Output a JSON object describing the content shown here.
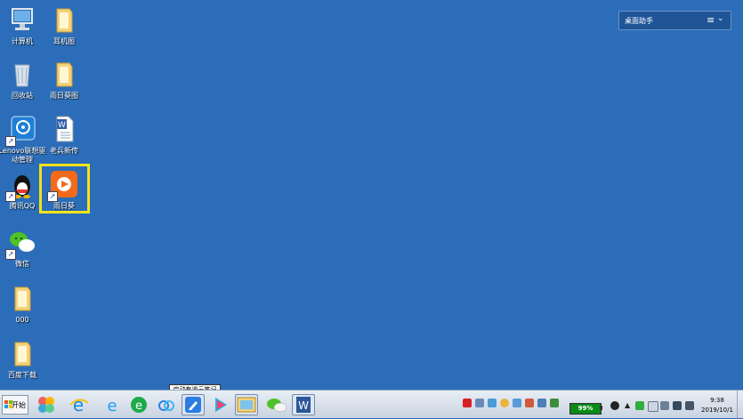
{
  "desktop": {
    "icons": [
      {
        "label": "计算机"
      },
      {
        "label": "耳机图"
      },
      {
        "label": "回收站"
      },
      {
        "label": "雨日葵图"
      },
      {
        "label": "Lenovo联想驱动管理"
      },
      {
        "label": "老兵新传"
      },
      {
        "label": "腾讯QQ"
      },
      {
        "label": "雨日葵"
      },
      {
        "label": "微信"
      },
      {
        "label": "000"
      },
      {
        "label": "百度下载"
      }
    ]
  },
  "assistant": {
    "title": "桌面助手",
    "menu_icon": "≡",
    "chevron_icon": "⌄"
  },
  "taskbar": {
    "start_label": "开始",
    "tooltip": "启动有道云笔记",
    "battery_percent": "99%",
    "clock_time": "9:38",
    "clock_date": "2019/10/1"
  },
  "colors": {
    "desktop": "#2c6db9",
    "highlight": "#f2e21a"
  }
}
